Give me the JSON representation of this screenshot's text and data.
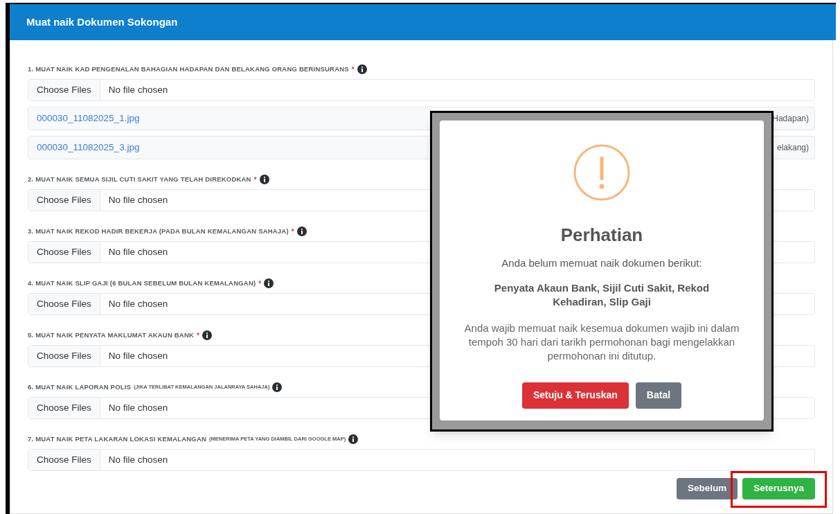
{
  "header": {
    "title": "Muat naik Dokumen Sokongan"
  },
  "sections": [
    {
      "label": "1. MUAT NAIK KAD PENGENALAN BAHAGIAN HADAPAN DAN BELAKANG ORANG BERINSURANS",
      "mark": "*",
      "choose": "Choose Files",
      "status": "No file chosen",
      "files": [
        {
          "name": "000030_11082025_1.jpg",
          "tag": "Hadapan)"
        },
        {
          "name": "000030_11082025_3.jpg",
          "tag": "elakang)"
        }
      ]
    },
    {
      "label": "2. MUAT NAIK SEMUA SIJIL CUTI SAKIT YANG TELAH DIREKODKAN",
      "mark": "*",
      "choose": "Choose Files",
      "status": "No file chosen"
    },
    {
      "label": "3. MUAT NAIK REKOD HADIR BEKERJA (PADA BULAN KEMALANGAN SAHAJA)",
      "mark": "*",
      "choose": "Choose Files",
      "status": "No file chosen"
    },
    {
      "label": "4. MUAT NAIK SLIP GAJI (6 BULAN SEBELUM BULAN KEMALANGAN)",
      "mark": "*",
      "choose": "Choose Files",
      "status": "No file chosen"
    },
    {
      "label": "5. MUAT NAIK PENYATA MAKLUMAT AKAUN BANK",
      "mark": "*",
      "choose": "Choose Files",
      "status": "No file chosen"
    },
    {
      "label": "6. MUAT NAIK LAPORAN POLIS",
      "note": "(JIKA TERLIBAT KEMALANGAN JALANRAYA SAHAJA)",
      "choose": "Choose Files",
      "status": "No file chosen"
    },
    {
      "label": "7. MUAT NAIK PETA LAKARAN LOKASI KEMALANGAN",
      "note": "(MENERIMA PETA YANG DIAMBIL DARI GOOGLE MAP)",
      "choose": "Choose Files",
      "status": "No file chosen"
    }
  ],
  "nav_buttons": [
    {
      "label": "Sebelum",
      "kind": "secondary",
      "highlighted": false
    },
    {
      "label": "Seterusnya",
      "kind": "primary",
      "highlighted": true
    }
  ],
  "dialog": {
    "title": "Perhatian",
    "message": "Anda belum memuat naik dokumen berikut:",
    "missing": "Penyata Akaun Bank, Sijil Cuti Sakit, Rekod Kehadiran, Slip Gaji",
    "notice": "Anda wajib memuat naik kesemua dokumen wajib ini dalam tempoh 30 hari dari tarikh permohonan bagi mengelakkan permohonan ini ditutup.",
    "buttons": [
      {
        "label": "Setuju & Teruskan",
        "kind": "danger"
      },
      {
        "label": "Batal",
        "kind": "secondary"
      }
    ]
  }
}
